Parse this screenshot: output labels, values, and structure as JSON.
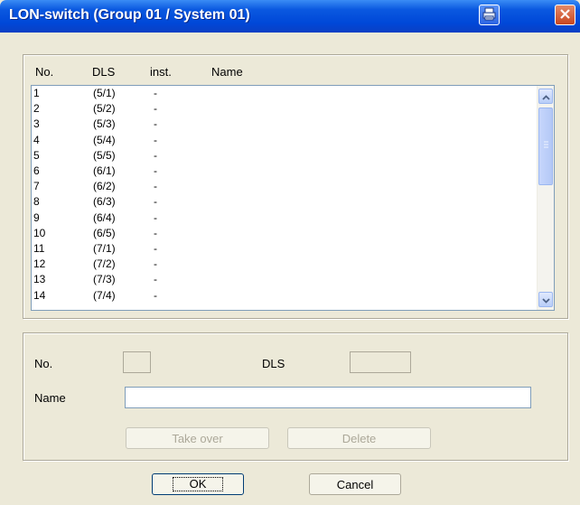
{
  "window": {
    "title": "LON-switch (Group 01 / System 01)",
    "print_icon": "printer-icon",
    "close_icon": "close-icon"
  },
  "list": {
    "headers": {
      "no": "No.",
      "dls": "DLS",
      "inst": "inst.",
      "name": "Name"
    },
    "rows": [
      {
        "no": "1",
        "dls": "(5/1)",
        "inst": "-",
        "name": ""
      },
      {
        "no": "2",
        "dls": "(5/2)",
        "inst": "-",
        "name": ""
      },
      {
        "no": "3",
        "dls": "(5/3)",
        "inst": "-",
        "name": ""
      },
      {
        "no": "4",
        "dls": "(5/4)",
        "inst": "-",
        "name": ""
      },
      {
        "no": "5",
        "dls": "(5/5)",
        "inst": "-",
        "name": ""
      },
      {
        "no": "6",
        "dls": "(6/1)",
        "inst": "-",
        "name": ""
      },
      {
        "no": "7",
        "dls": "(6/2)",
        "inst": "-",
        "name": ""
      },
      {
        "no": "8",
        "dls": "(6/3)",
        "inst": "-",
        "name": ""
      },
      {
        "no": "9",
        "dls": "(6/4)",
        "inst": "-",
        "name": ""
      },
      {
        "no": "10",
        "dls": "(6/5)",
        "inst": "-",
        "name": ""
      },
      {
        "no": "11",
        "dls": "(7/1)",
        "inst": "-",
        "name": ""
      },
      {
        "no": "12",
        "dls": "(7/2)",
        "inst": "-",
        "name": ""
      },
      {
        "no": "13",
        "dls": "(7/3)",
        "inst": "-",
        "name": ""
      },
      {
        "no": "14",
        "dls": "(7/4)",
        "inst": "-",
        "name": ""
      }
    ]
  },
  "editor": {
    "no_label": "No.",
    "no_value": "",
    "dls_label": "DLS",
    "dls_value": "",
    "name_label": "Name",
    "name_value": "",
    "take_over_label": "Take over",
    "delete_label": "Delete"
  },
  "footer": {
    "ok_label": "OK",
    "cancel_label": "Cancel"
  },
  "colors": {
    "titlebar": "#0a58e0",
    "dialog_bg": "#ece9d8",
    "close_button": "#c9461f"
  }
}
